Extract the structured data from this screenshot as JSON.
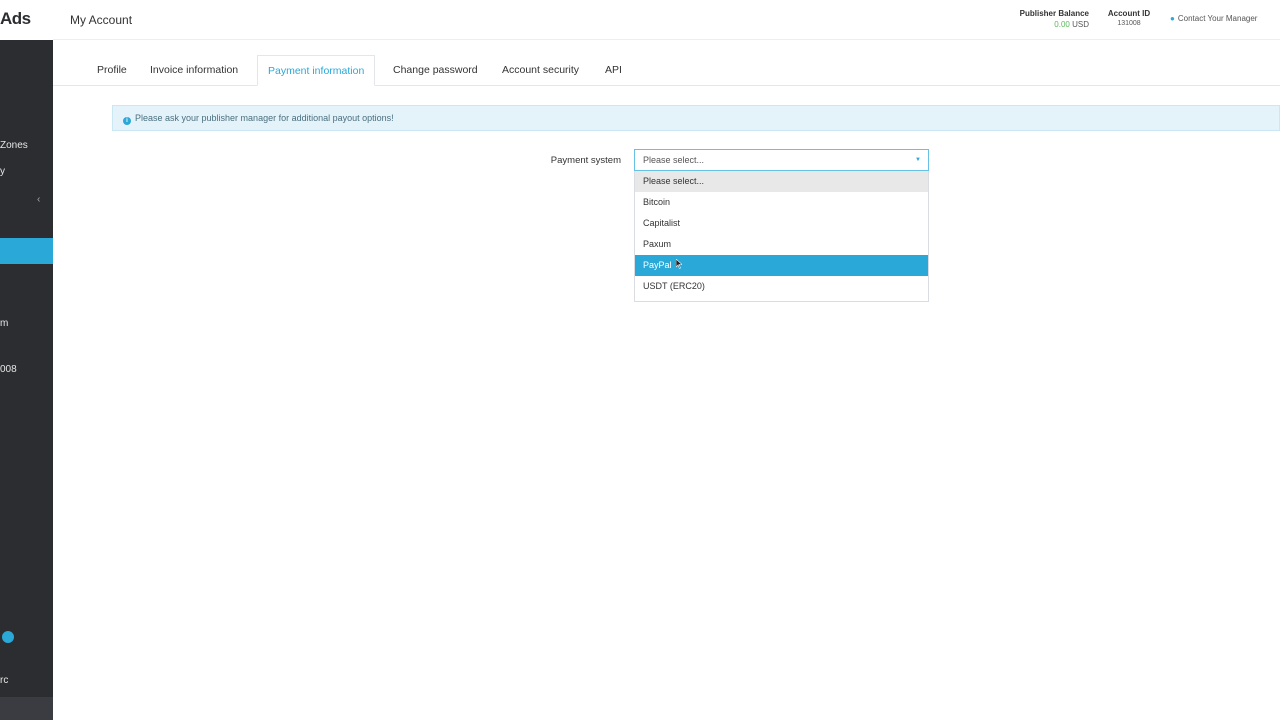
{
  "sidebar": {
    "logo": "Ads",
    "items": [
      {
        "label": "Zones"
      },
      {
        "label": "y"
      },
      {
        "label": "m"
      },
      {
        "label": "008"
      },
      {
        "label": "rc"
      }
    ]
  },
  "header": {
    "title": "My Account",
    "publisher_balance_label": "Publisher Balance",
    "publisher_balance_value": "0.00",
    "publisher_balance_currency": "USD",
    "account_id_label": "Account ID",
    "account_id_value": "131008",
    "contact_manager": "Contact Your Manager"
  },
  "tabs": [
    {
      "label": "Profile",
      "active": false
    },
    {
      "label": "Invoice information",
      "active": false
    },
    {
      "label": "Payment information",
      "active": true
    },
    {
      "label": "Change password",
      "active": false
    },
    {
      "label": "Account security",
      "active": false
    },
    {
      "label": "API",
      "active": false
    }
  ],
  "alert": {
    "text": "Please ask your publisher manager for additional payout options!"
  },
  "form": {
    "payment_system_label": "Payment system",
    "select_value": "Please select...",
    "options": [
      {
        "label": "Please select...",
        "state": "hovered"
      },
      {
        "label": "Bitcoin",
        "state": ""
      },
      {
        "label": "Capitalist",
        "state": ""
      },
      {
        "label": "Paxum",
        "state": ""
      },
      {
        "label": "PayPal",
        "state": "selected"
      },
      {
        "label": "USDT (ERC20)",
        "state": ""
      }
    ]
  },
  "colors": {
    "accent": "#2aa8d8",
    "sidebar_bg": "#2b2d31",
    "balance_green": "#5cb85c"
  }
}
